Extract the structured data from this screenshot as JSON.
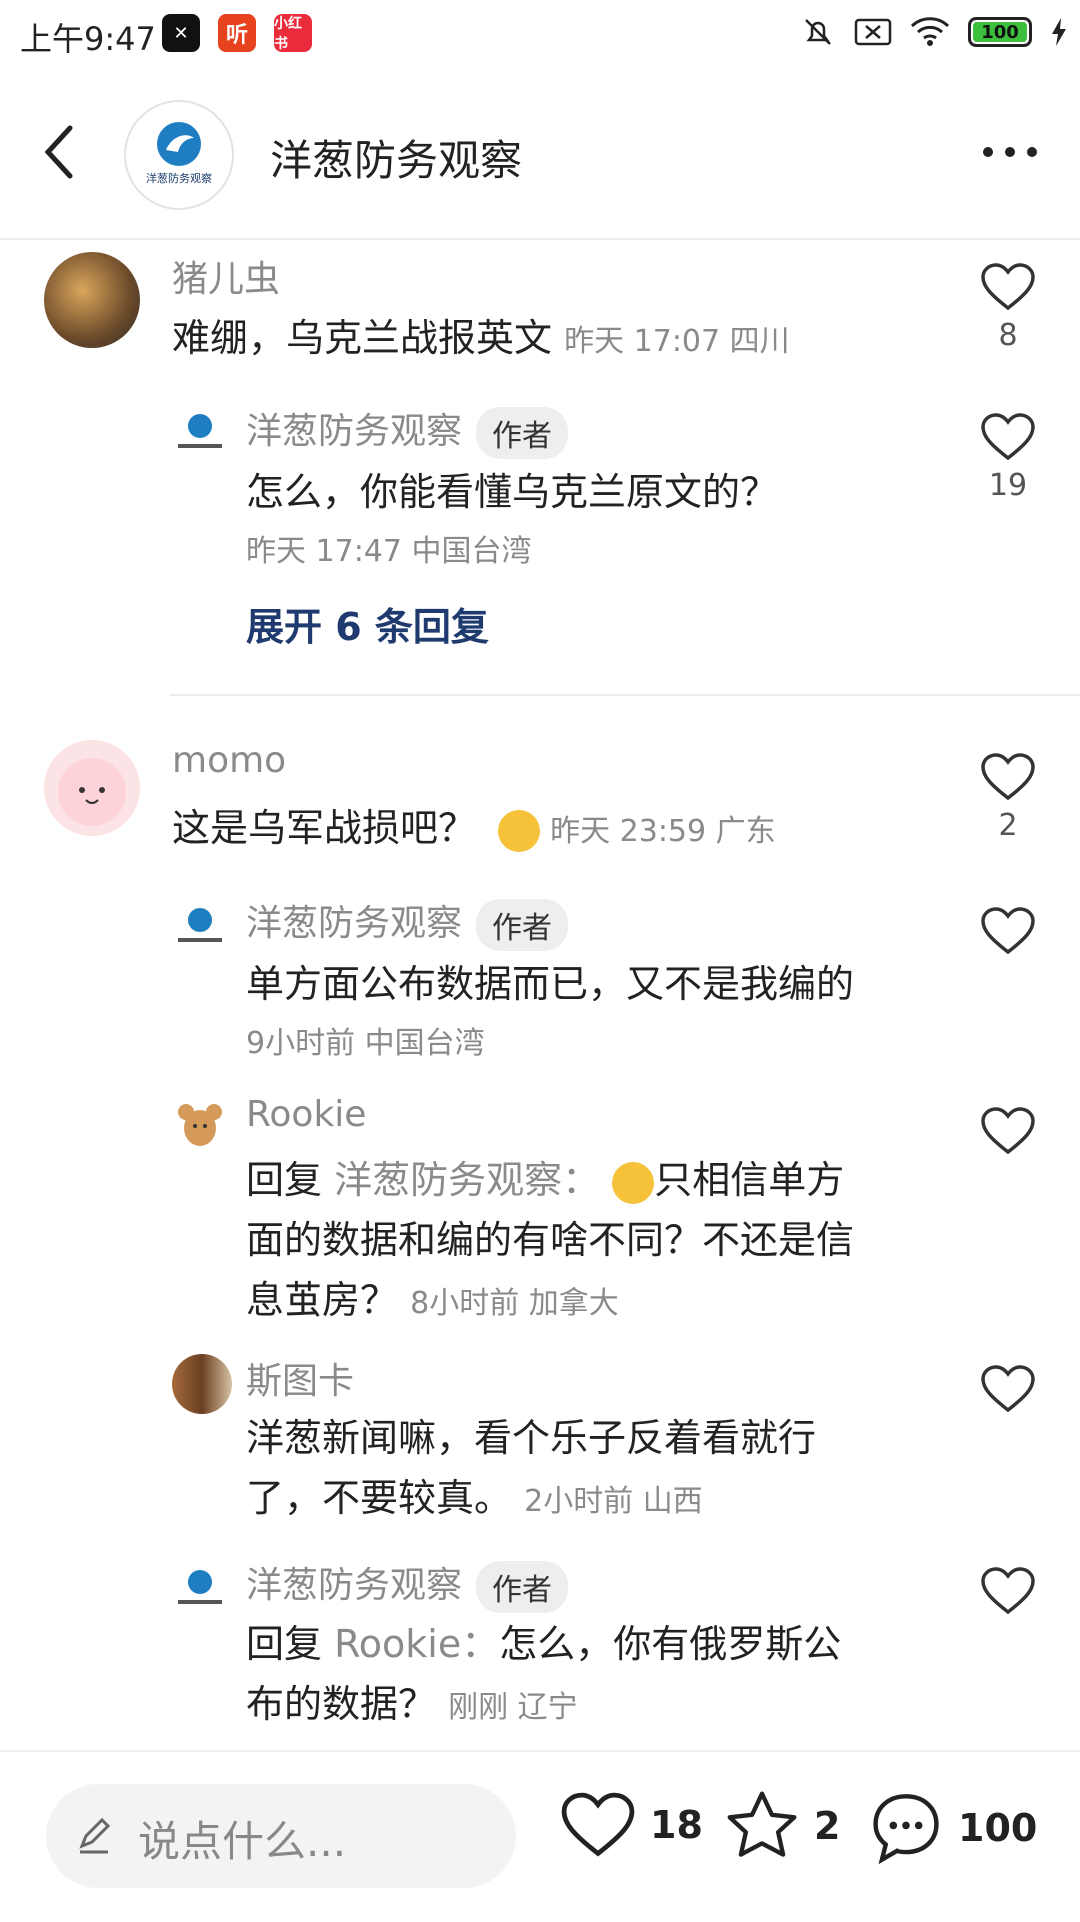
{
  "status_bar": {
    "time": "上午9:47",
    "battery": "100",
    "apps": [
      "CapCut",
      "听",
      "小红书"
    ]
  },
  "header": {
    "title": "洋葱防务观察",
    "logo_text": "洋葱防务观察"
  },
  "comments": [
    {
      "name": "猪儿虫",
      "text": "难绷，乌克兰战报英文",
      "meta": "昨天 17:07 四川",
      "likes": "8"
    },
    {
      "name": "洋葱防务观察",
      "badge": "作者",
      "text": "怎么，你能看懂乌克兰原文的？",
      "meta": "昨天 17:47 中国台湾",
      "likes": "19"
    },
    {
      "name": "momo",
      "text": "这是乌军战损吧？",
      "meta": "昨天 23:59 广东",
      "likes": "2"
    },
    {
      "name": "洋葱防务观察",
      "badge": "作者",
      "text": "单方面公布数据而已，又不是我编的",
      "meta": "9小时前  中国台湾"
    },
    {
      "name": "Rookie",
      "reply_prefix": "回复",
      "reply_to": "洋葱防务观察：",
      "text_line1": "只相信单方",
      "text_line2": "面的数据和编的有啥不同？不还是信",
      "text_line3": "息茧房？",
      "meta": "8小时前  加拿大"
    },
    {
      "name": "斯图卡",
      "text_line1": "洋葱新闻嘛，看个乐子反着看就行",
      "text_line2": "了，不要较真。",
      "meta": "2小时前  山西"
    },
    {
      "name": "洋葱防务观察",
      "badge": "作者",
      "reply_prefix": "回复",
      "reply_to": "Rookie：",
      "text_line1": "怎么，你有俄罗斯公",
      "text_line2": "布的数据？",
      "meta": "刚刚  辽宁"
    }
  ],
  "expand_replies": "展开 6 条回复",
  "bottom_bar": {
    "placeholder": "说点什么...",
    "likes": "18",
    "stars": "2",
    "comments": "100"
  }
}
